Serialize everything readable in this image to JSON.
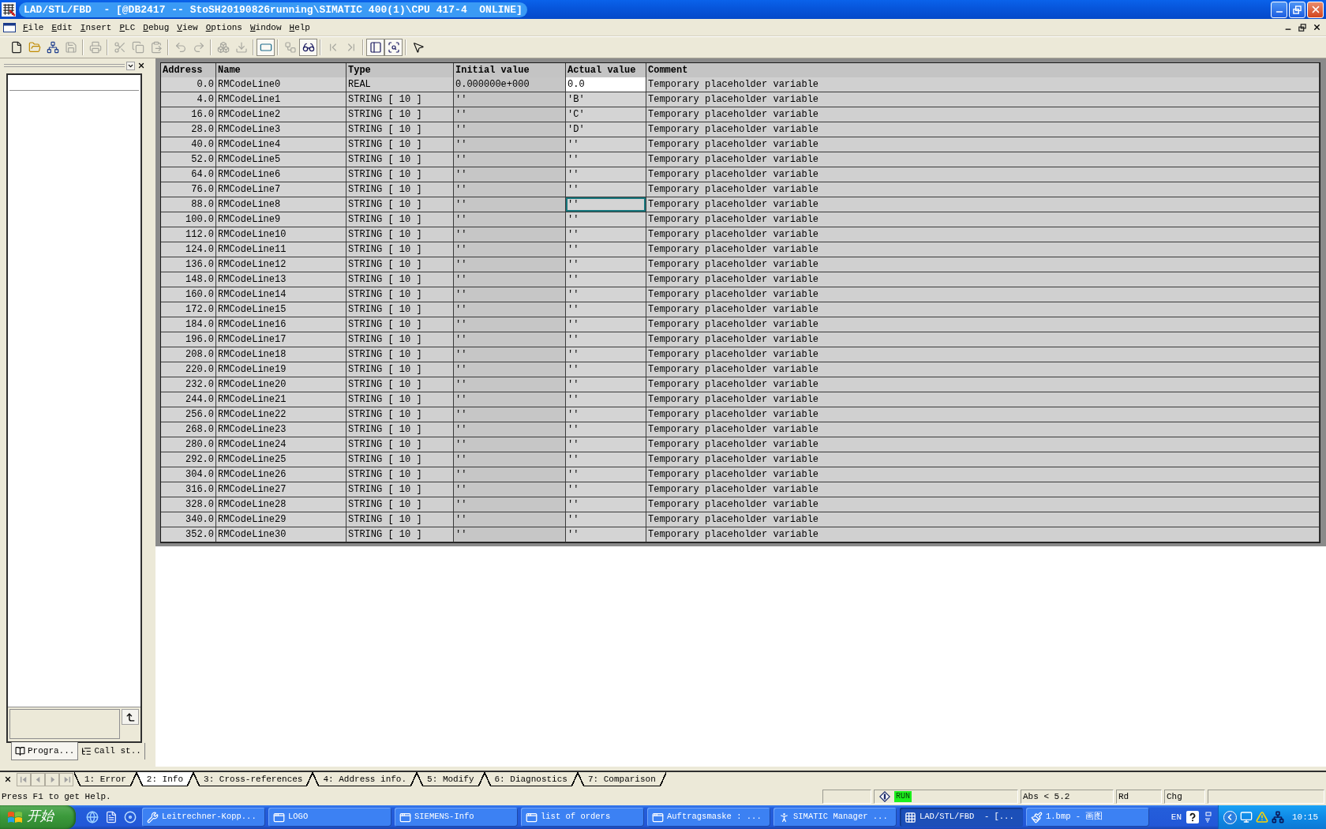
{
  "window": {
    "title": "LAD/STL/FBD  - [@DB2417 -- StoSH20190826running\\SIMATIC 400(1)\\CPU 417-4  ONLINE]"
  },
  "menu": [
    "File",
    "Edit",
    "Insert",
    "PLC",
    "Debug",
    "View",
    "Options",
    "Window",
    "Help"
  ],
  "toolbar": {
    "groups": [
      {
        "buttons": [
          {
            "disabled": false,
            "pressed": false
          },
          {
            "disabled": false,
            "pressed": false
          },
          {
            "disabled": false,
            "pressed": false
          },
          {
            "disabled": true,
            "pressed": false
          }
        ]
      },
      {
        "buttons": [
          {
            "disabled": true,
            "pressed": false
          }
        ]
      },
      {
        "buttons": [
          {
            "disabled": true,
            "pressed": false
          },
          {
            "disabled": true,
            "pressed": false
          },
          {
            "disabled": true,
            "pressed": false
          }
        ]
      },
      {
        "buttons": [
          {
            "disabled": true,
            "pressed": false
          },
          {
            "disabled": true,
            "pressed": false
          }
        ]
      },
      {
        "buttons": [
          {
            "disabled": true,
            "pressed": false
          },
          {
            "disabled": true,
            "pressed": false
          }
        ]
      },
      {
        "buttons": [
          {
            "disabled": false,
            "pressed": true
          }
        ]
      },
      {
        "buttons": [
          {
            "disabled": true,
            "pressed": false
          },
          {
            "disabled": false,
            "pressed": true
          }
        ]
      },
      {
        "buttons": [
          {
            "disabled": true,
            "pressed": false
          },
          {
            "disabled": true,
            "pressed": false
          }
        ]
      },
      {
        "buttons": [
          {
            "disabled": false,
            "pressed": true
          },
          {
            "disabled": false,
            "pressed": true
          }
        ]
      },
      {
        "buttons": [
          {
            "disabled": false,
            "pressed": false
          }
        ]
      }
    ]
  },
  "left_panel": {
    "tabs": [
      {
        "label": "Progra...",
        "selected": true
      },
      {
        "label": "Call st..",
        "selected": false
      }
    ]
  },
  "table": {
    "columns": [
      "Address",
      "Name",
      "Type",
      "Initial value",
      "Actual value",
      "Comment"
    ],
    "rows": [
      {
        "address": "0.0",
        "name": "RMCodeLine0",
        "type": "REAL",
        "initial_value": "0.000000e+000",
        "actual_value": "0.0",
        "comment": "Temporary placeholder variable",
        "actual_highlighted": true,
        "actual_focused": false
      },
      {
        "address": "4.0",
        "name": "RMCodeLine1",
        "type": "STRING [ 10 ]",
        "initial_value": "''",
        "actual_value": "'B'",
        "comment": "Temporary placeholder variable",
        "actual_highlighted": false,
        "actual_focused": false
      },
      {
        "address": "16.0",
        "name": "RMCodeLine2",
        "type": "STRING [ 10 ]",
        "initial_value": "''",
        "actual_value": "'C'",
        "comment": "Temporary placeholder variable",
        "actual_highlighted": false,
        "actual_focused": false
      },
      {
        "address": "28.0",
        "name": "RMCodeLine3",
        "type": "STRING [ 10 ]",
        "initial_value": "''",
        "actual_value": "'D'",
        "comment": "Temporary placeholder variable",
        "actual_highlighted": false,
        "actual_focused": false
      },
      {
        "address": "40.0",
        "name": "RMCodeLine4",
        "type": "STRING [ 10 ]",
        "initial_value": "''",
        "actual_value": "''",
        "comment": "Temporary placeholder variable",
        "actual_highlighted": false,
        "actual_focused": false
      },
      {
        "address": "52.0",
        "name": "RMCodeLine5",
        "type": "STRING [ 10 ]",
        "initial_value": "''",
        "actual_value": "''",
        "comment": "Temporary placeholder variable",
        "actual_highlighted": false,
        "actual_focused": false
      },
      {
        "address": "64.0",
        "name": "RMCodeLine6",
        "type": "STRING [ 10 ]",
        "initial_value": "''",
        "actual_value": "''",
        "comment": "Temporary placeholder variable",
        "actual_highlighted": false,
        "actual_focused": false
      },
      {
        "address": "76.0",
        "name": "RMCodeLine7",
        "type": "STRING [ 10 ]",
        "initial_value": "''",
        "actual_value": "''",
        "comment": "Temporary placeholder variable",
        "actual_highlighted": false,
        "actual_focused": false
      },
      {
        "address": "88.0",
        "name": "RMCodeLine8",
        "type": "STRING [ 10 ]",
        "initial_value": "''",
        "actual_value": "''",
        "comment": "Temporary placeholder variable",
        "actual_highlighted": false,
        "actual_focused": true
      },
      {
        "address": "100.0",
        "name": "RMCodeLine9",
        "type": "STRING [ 10 ]",
        "initial_value": "''",
        "actual_value": "''",
        "comment": "Temporary placeholder variable",
        "actual_highlighted": false,
        "actual_focused": false
      },
      {
        "address": "112.0",
        "name": "RMCodeLine10",
        "type": "STRING [ 10 ]",
        "initial_value": "''",
        "actual_value": "''",
        "comment": "Temporary placeholder variable",
        "actual_highlighted": false,
        "actual_focused": false
      },
      {
        "address": "124.0",
        "name": "RMCodeLine11",
        "type": "STRING [ 10 ]",
        "initial_value": "''",
        "actual_value": "''",
        "comment": "Temporary placeholder variable",
        "actual_highlighted": false,
        "actual_focused": false
      },
      {
        "address": "136.0",
        "name": "RMCodeLine12",
        "type": "STRING [ 10 ]",
        "initial_value": "''",
        "actual_value": "''",
        "comment": "Temporary placeholder variable",
        "actual_highlighted": false,
        "actual_focused": false
      },
      {
        "address": "148.0",
        "name": "RMCodeLine13",
        "type": "STRING [ 10 ]",
        "initial_value": "''",
        "actual_value": "''",
        "comment": "Temporary placeholder variable",
        "actual_highlighted": false,
        "actual_focused": false
      },
      {
        "address": "160.0",
        "name": "RMCodeLine14",
        "type": "STRING [ 10 ]",
        "initial_value": "''",
        "actual_value": "''",
        "comment": "Temporary placeholder variable",
        "actual_highlighted": false,
        "actual_focused": false
      },
      {
        "address": "172.0",
        "name": "RMCodeLine15",
        "type": "STRING [ 10 ]",
        "initial_value": "''",
        "actual_value": "''",
        "comment": "Temporary placeholder variable",
        "actual_highlighted": false,
        "actual_focused": false
      },
      {
        "address": "184.0",
        "name": "RMCodeLine16",
        "type": "STRING [ 10 ]",
        "initial_value": "''",
        "actual_value": "''",
        "comment": "Temporary placeholder variable",
        "actual_highlighted": false,
        "actual_focused": false
      },
      {
        "address": "196.0",
        "name": "RMCodeLine17",
        "type": "STRING [ 10 ]",
        "initial_value": "''",
        "actual_value": "''",
        "comment": "Temporary placeholder variable",
        "actual_highlighted": false,
        "actual_focused": false
      },
      {
        "address": "208.0",
        "name": "RMCodeLine18",
        "type": "STRING [ 10 ]",
        "initial_value": "''",
        "actual_value": "''",
        "comment": "Temporary placeholder variable",
        "actual_highlighted": false,
        "actual_focused": false
      },
      {
        "address": "220.0",
        "name": "RMCodeLine19",
        "type": "STRING [ 10 ]",
        "initial_value": "''",
        "actual_value": "''",
        "comment": "Temporary placeholder variable",
        "actual_highlighted": false,
        "actual_focused": false
      },
      {
        "address": "232.0",
        "name": "RMCodeLine20",
        "type": "STRING [ 10 ]",
        "initial_value": "''",
        "actual_value": "''",
        "comment": "Temporary placeholder variable",
        "actual_highlighted": false,
        "actual_focused": false
      },
      {
        "address": "244.0",
        "name": "RMCodeLine21",
        "type": "STRING [ 10 ]",
        "initial_value": "''",
        "actual_value": "''",
        "comment": "Temporary placeholder variable",
        "actual_highlighted": false,
        "actual_focused": false
      },
      {
        "address": "256.0",
        "name": "RMCodeLine22",
        "type": "STRING [ 10 ]",
        "initial_value": "''",
        "actual_value": "''",
        "comment": "Temporary placeholder variable",
        "actual_highlighted": false,
        "actual_focused": false
      },
      {
        "address": "268.0",
        "name": "RMCodeLine23",
        "type": "STRING [ 10 ]",
        "initial_value": "''",
        "actual_value": "''",
        "comment": "Temporary placeholder variable",
        "actual_highlighted": false,
        "actual_focused": false
      },
      {
        "address": "280.0",
        "name": "RMCodeLine24",
        "type": "STRING [ 10 ]",
        "initial_value": "''",
        "actual_value": "''",
        "comment": "Temporary placeholder variable",
        "actual_highlighted": false,
        "actual_focused": false
      },
      {
        "address": "292.0",
        "name": "RMCodeLine25",
        "type": "STRING [ 10 ]",
        "initial_value": "''",
        "actual_value": "''",
        "comment": "Temporary placeholder variable",
        "actual_highlighted": false,
        "actual_focused": false
      },
      {
        "address": "304.0",
        "name": "RMCodeLine26",
        "type": "STRING [ 10 ]",
        "initial_value": "''",
        "actual_value": "''",
        "comment": "Temporary placeholder variable",
        "actual_highlighted": false,
        "actual_focused": false
      },
      {
        "address": "316.0",
        "name": "RMCodeLine27",
        "type": "STRING [ 10 ]",
        "initial_value": "''",
        "actual_value": "''",
        "comment": "Temporary placeholder variable",
        "actual_highlighted": false,
        "actual_focused": false
      },
      {
        "address": "328.0",
        "name": "RMCodeLine28",
        "type": "STRING [ 10 ]",
        "initial_value": "''",
        "actual_value": "''",
        "comment": "Temporary placeholder variable",
        "actual_highlighted": false,
        "actual_focused": false
      },
      {
        "address": "340.0",
        "name": "RMCodeLine29",
        "type": "STRING [ 10 ]",
        "initial_value": "''",
        "actual_value": "''",
        "comment": "Temporary placeholder variable",
        "actual_highlighted": false,
        "actual_focused": false
      },
      {
        "address": "352.0",
        "name": "RMCodeLine30",
        "type": "STRING [ 10 ]",
        "initial_value": "''",
        "actual_value": "''",
        "comment": "Temporary placeholder variable",
        "actual_highlighted": false,
        "actual_focused": false
      }
    ]
  },
  "output_tabs": {
    "nav_buttons": [
      {
        "disabled": true
      },
      {
        "disabled": true
      },
      {
        "disabled": true
      },
      {
        "disabled": true
      }
    ],
    "tabs": [
      {
        "label": "1: Error",
        "selected": false
      },
      {
        "label": "2: Info",
        "selected": true
      },
      {
        "label": "3: Cross-references",
        "selected": false
      },
      {
        "label": "4: Address info.",
        "selected": false
      },
      {
        "label": "5: Modify",
        "selected": false
      },
      {
        "label": "6: Diagnostics",
        "selected": false
      },
      {
        "label": "7: Comparison",
        "selected": false
      }
    ]
  },
  "status_bar": {
    "help": "Press F1 to get Help.",
    "cpu_state": {
      "text": "RUN",
      "running": true
    },
    "fields": [
      "Abs < 5.2",
      "Rd",
      "Chg"
    ]
  },
  "taskbar": {
    "start": "开始",
    "tasks": [
      {
        "label": "Leitrechner-Kopp...",
        "selected": false
      },
      {
        "label": "LOGO",
        "selected": false
      },
      {
        "label": "SIEMENS-Info",
        "selected": false
      },
      {
        "label": "list of orders",
        "selected": false
      },
      {
        "label": "Auftragsmaske : ...",
        "selected": false
      },
      {
        "label": "SIMATIC Manager ...",
        "selected": false
      },
      {
        "label": "LAD/STL/FBD  - [...",
        "selected": true
      },
      {
        "label": "1.bmp - 画图",
        "selected": false
      }
    ],
    "language": "EN",
    "clock": "10:15"
  }
}
